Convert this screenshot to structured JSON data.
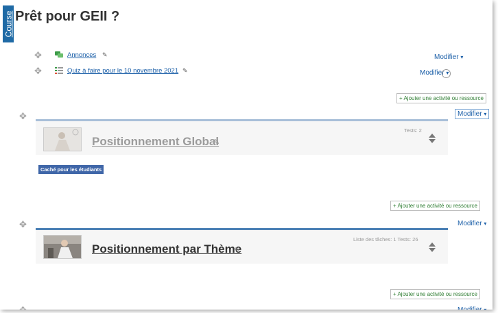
{
  "course_tab": {
    "label": "Course"
  },
  "page": {
    "title": "Prêt pour GEII ?"
  },
  "activities": [
    {
      "name": "Annonces",
      "icon": "forum-icon"
    },
    {
      "name": "Quiz à faire pour le 10 novembre 2021",
      "icon": "quiz-icon"
    }
  ],
  "modifier_label": "Modifier",
  "add_activity_label": "+ Ajouter une activité ou ressource",
  "sections": [
    {
      "title": "Positionnement Global",
      "meta": "Tests: 2",
      "badge": "Caché pour les étudiants",
      "bar_color": "#a8bfd9",
      "title_color": "#9b9b9b"
    },
    {
      "title": "Positionnement par Thème",
      "meta": "Liste des tâches: 1 Tests: 26",
      "bar_color": "#4a7fb5",
      "title_color": "#333333"
    }
  ],
  "colors": {
    "brand": "#1f6aa5",
    "link": "#1b5fa8",
    "add_text": "#2e7d32"
  }
}
